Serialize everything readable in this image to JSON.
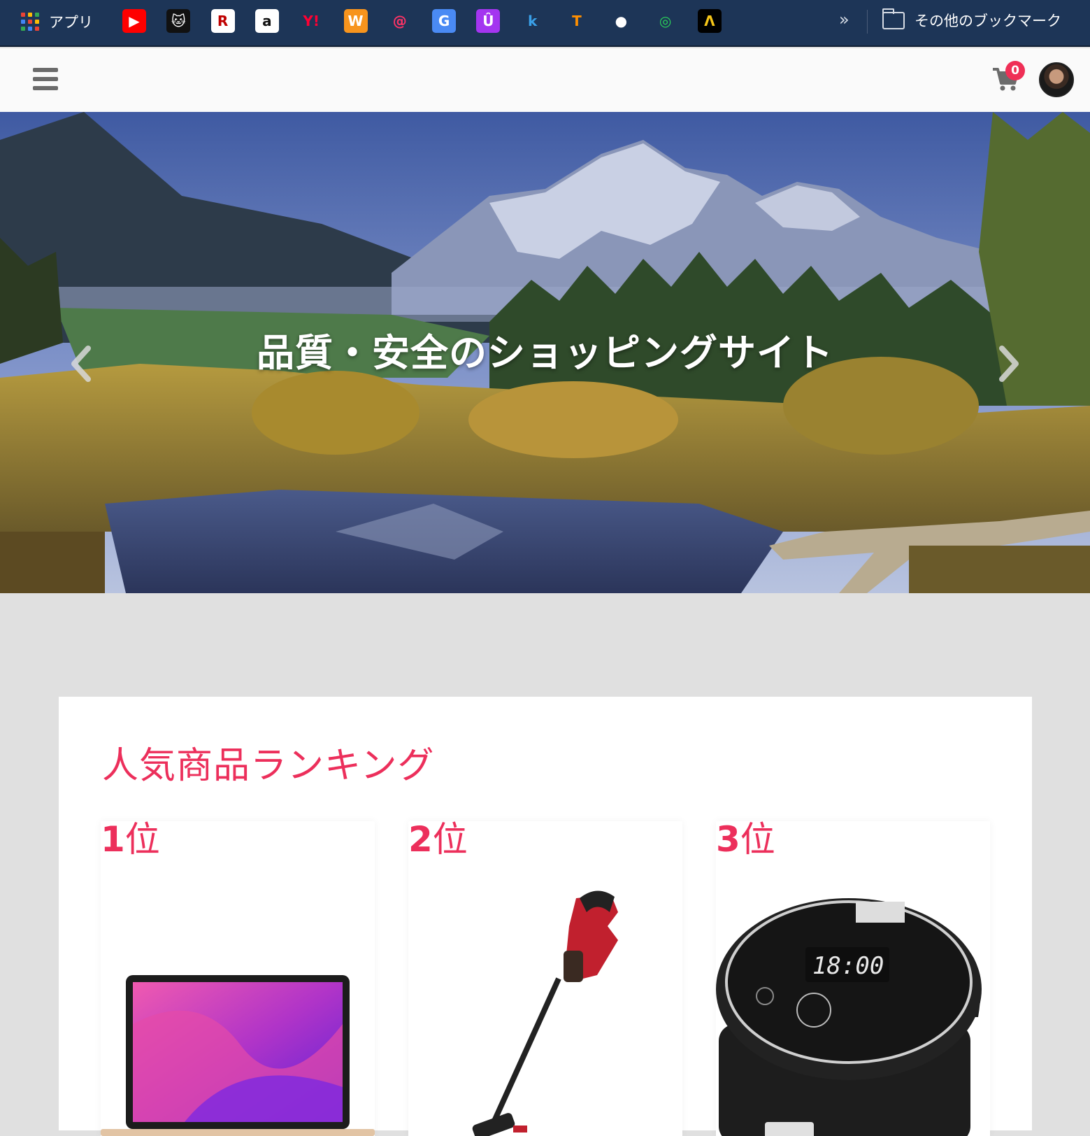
{
  "bookmarks": {
    "apps_label": "アプリ",
    "items": [
      {
        "name": "youtube-icon",
        "glyph": "▶",
        "bg": "#ff0000",
        "fg": "#ffffff"
      },
      {
        "name": "cat-icon",
        "glyph": "🐱",
        "bg": "#111111",
        "fg": "#ffffff"
      },
      {
        "name": "rakuten-icon",
        "glyph": "R",
        "bg": "#ffffff",
        "fg": "#bf0000"
      },
      {
        "name": "amazon-icon",
        "glyph": "a",
        "bg": "#ffffff",
        "fg": "#111111"
      },
      {
        "name": "yahoo-icon",
        "glyph": "Y!",
        "bg": "transparent",
        "fg": "#ff0033"
      },
      {
        "name": "w-icon",
        "glyph": "W",
        "bg": "#f7941d",
        "fg": "#ffffff"
      },
      {
        "name": "at-icon",
        "glyph": "@",
        "bg": "transparent",
        "fg": "#ff3366"
      },
      {
        "name": "google-translate-icon",
        "glyph": "G",
        "bg": "#4a8af4",
        "fg": "#ffffff"
      },
      {
        "name": "udemy-icon",
        "glyph": "Û",
        "bg": "#a435f0",
        "fg": "#ffffff"
      },
      {
        "name": "k-icon",
        "glyph": "k",
        "bg": "transparent",
        "fg": "#3aa0e8"
      },
      {
        "name": "tensorflow-icon",
        "glyph": "T",
        "bg": "transparent",
        "fg": "#ff8f00"
      },
      {
        "name": "github-icon",
        "glyph": "●",
        "bg": "transparent",
        "fg": "#ffffff"
      },
      {
        "name": "circle-icon",
        "glyph": "◎",
        "bg": "transparent",
        "fg": "#2bd45a"
      },
      {
        "name": "lambda-icon",
        "glyph": "Λ",
        "bg": "#000000",
        "fg": "#f5c518"
      }
    ],
    "more_label": "»",
    "folder_label": "その他のブックマーク"
  },
  "header": {
    "cart_count": "0"
  },
  "hero": {
    "title": "品質・安全のショッピングサイト"
  },
  "ranking": {
    "title": "人気商品ランキング",
    "items": [
      {
        "rank": "1",
        "suffix": "位",
        "product": "laptop"
      },
      {
        "rank": "2",
        "suffix": "位",
        "product": "stick-vacuum"
      },
      {
        "rank": "3",
        "suffix": "位",
        "product": "rice-cooker"
      }
    ]
  },
  "colors": {
    "bookmark_bar": "#1d3557",
    "accent": "#ec2f5b",
    "badge": "#ef2f56",
    "page_bg": "#e0e0e0"
  }
}
